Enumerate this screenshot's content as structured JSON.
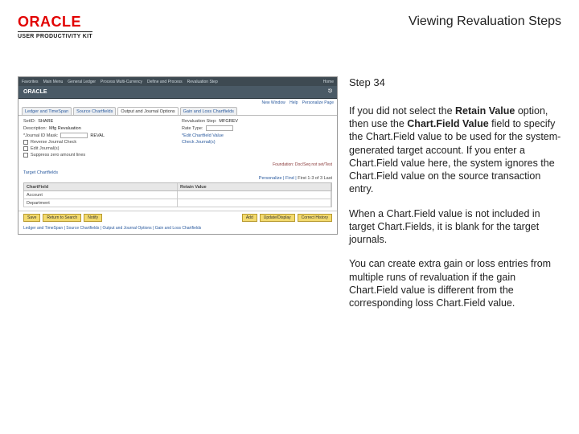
{
  "header": {
    "brand": "ORACLE",
    "subbrand": "USER PRODUCTIVITY KIT",
    "title": "Viewing Revaluation Steps"
  },
  "panel": {
    "step": "Step 34",
    "para1_pre": "If you did not select the ",
    "bold1": "Retain Value",
    "para1_mid": " option, then use the ",
    "bold2": "Chart.Field Value",
    "para1_post": " field to specify the Chart.Field value to be used for the system-generated target account. If you enter a Chart.Field value here, the system ignores the Chart.Field value on the source transaction entry.",
    "para2": "When a Chart.Field value is not included in target Chart.Fields, it is blank for the target journals.",
    "para3": "You can create extra gain or loss entries from multiple runs of revaluation if the gain Chart.Field value is different from the corresponding loss Chart.Field value."
  },
  "app": {
    "top_items": [
      "Favorites",
      "Main Menu",
      "General Ledger",
      "Process Multi-Currency",
      "Define and Process",
      "Revaluation Step"
    ],
    "top_home": "Home",
    "brand": "ORACLE",
    "sublinks": [
      "New Window",
      "Help",
      "Personalize Page"
    ],
    "tabs": [
      "Ledger and TimeSpan",
      "Source Chartfields",
      "Output and Journal Options",
      "Gain and Loss Chartfields"
    ],
    "active_tab": 2,
    "form": {
      "setid_lbl": "SetID:",
      "setid_val": "SHARE",
      "step_lbl": "Revaluation Step:",
      "step_val": "MFGREV",
      "descr_lbl": "Description:",
      "descr_val": "Mfg Revaluation",
      "rate_lbl": "Rate Type:",
      "jrnl_lbl": "*Journal ID Mask:",
      "jrnl_val": "REVAL",
      "cb1": "Reverse Journal Check",
      "cb2": "Edit Journal(s)",
      "cb3": "Suppress zero amount lines",
      "link1": "*Edit Chartfield Value",
      "link2": "Check Journal(s)",
      "faux": "Foundation: Doc/Seq not set/Test"
    },
    "section": {
      "title": "Target Chartfields",
      "personalize": "Personalize | Find |",
      "range": "First 1-3 of 3 Last",
      "col1": "ChartField",
      "col2": "Retain Value",
      "rows": [
        {
          "c1": "Account",
          "c2": ""
        },
        {
          "c1": "Department",
          "c2": ""
        }
      ]
    },
    "buttons": [
      "Save",
      "Return to Search",
      "Notify",
      "Add",
      "Update/Display",
      "Correct History"
    ],
    "bottom_tabs": "Ledger and TimeSpan | Source Chartfields | Output and Journal Options | Gain and Loss Chartfields"
  }
}
